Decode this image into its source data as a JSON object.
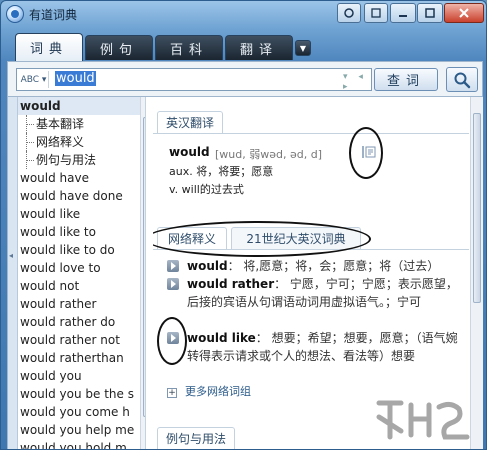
{
  "window": {
    "title": "有道词典"
  },
  "tabs": [
    {
      "label": "词典",
      "active": true
    },
    {
      "label": "例句",
      "active": false
    },
    {
      "label": "百科",
      "active": false
    },
    {
      "label": "翻译",
      "active": false
    }
  ],
  "search": {
    "mode_label": "ABC",
    "value": "would",
    "query_button": "查词"
  },
  "word_list": {
    "head": "would",
    "sub_items": [
      "基本翻译",
      "网络释义",
      "例句与用法"
    ],
    "items": [
      "would have",
      "would have done",
      "would like",
      "would like to",
      "would like to do",
      "would love to",
      "would not",
      "would rather",
      "would rather do",
      "would rather not",
      "would ratherthan",
      "would you",
      "would you be the s",
      "would you come h",
      "would you help me",
      "would you hold m"
    ]
  },
  "basic": {
    "section_title": "英汉翻译",
    "word": "would",
    "phonetic": "[wud, 弱wəd, əd, d]",
    "definitions": [
      "aux. 将，将要；愿意",
      "v. will的过去式"
    ]
  },
  "net": {
    "tab_net": "网络释义",
    "tab_21": "21世纪大英汉词典",
    "items": [
      {
        "term": "would",
        "meaning": "： 将,愿意；将，会；愿意；将（过去）"
      },
      {
        "term": "would rather",
        "meaning": "： 宁愿，宁可；宁愿；表示愿望，后接的宾语从句谓语动词用虚拟语气。；宁可"
      },
      {
        "term": "would like",
        "meaning": "： 想要；希望；想要，愿意；（语气婉转得表示请求或个人的想法、看法等）想要"
      }
    ],
    "more_label": "更多网络词组"
  },
  "examples": {
    "section_title": "例句与用法"
  },
  "colors": {
    "accent": "#3a7bd5",
    "titlebar": "#6fa3d3",
    "tab_dark": "#1a2530"
  },
  "icons": [
    "app-logo-icon",
    "minimize-icon",
    "maximize-icon",
    "close-icon",
    "search-icon",
    "speaker-icon",
    "play-icon",
    "plus-icon"
  ]
}
